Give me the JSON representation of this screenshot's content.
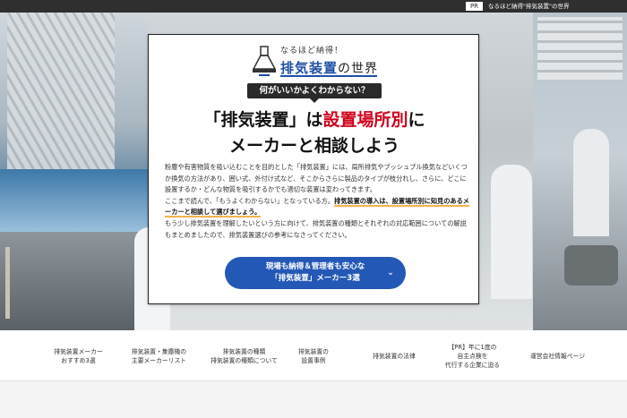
{
  "topbar": {
    "pr_label": "PR",
    "site_tagline": "なるほど納得\"排気装置\"の世界"
  },
  "logo": {
    "tagline": "なるほど納得！",
    "name_main": "排気装置",
    "name_suffix": "の世界"
  },
  "subhead": "何がいいかよくわからない？",
  "headline": {
    "line1_pre": "「排気装置」は",
    "line1_red": "設置場所別",
    "line1_post": "に",
    "line2": "メーカーと相談しよう"
  },
  "body": {
    "p1": "粉塵や有害物質を吸い込むことを目的とした「排気装置」には、局所排気やプッシュプル換気などいくつか換気の方法があり、囲い式、外付け式など、そこからさらに製品のタイプが枝分れし、さらに、どこに設置するか・どんな物質を吸引するかでも適切な装置は変わってきます。",
    "p2_pre": "ここまで読んで、「もうよくわからない」となっている方。",
    "p2_red": "排気装置の導入は、設置場所別に知見のあるメーカーと相談して選びましょう。",
    "p3": "もう少し排気装置を理解したいという方に向けて、排気装置の種類とそれぞれの対応範囲についての解説もまとめましたので、排気装置選びの参考になさってください。"
  },
  "cta": {
    "line1": "現場も納得＆管理者も安心な",
    "line2": "「排気装置」メーカー3選"
  },
  "nav": {
    "items": [
      {
        "label": "排気装置メーカー\nおすすめ3選"
      },
      {
        "label": "排気装置・集塵機の\n主要メーカーリスト"
      },
      {
        "label": "排気装置の種類\n排気装置の種類について"
      },
      {
        "label": "排気装置の\n設置事例"
      },
      {
        "label": "排気装置の法律"
      },
      {
        "label": "【PR】年に1度の\n自主点検を\n代行する企業に迫る"
      },
      {
        "label": "運営会社情報ページ"
      }
    ]
  },
  "colors": {
    "accent_blue": "#2458b6",
    "accent_red": "#d0001b",
    "topbar": "#2f2f2f"
  }
}
